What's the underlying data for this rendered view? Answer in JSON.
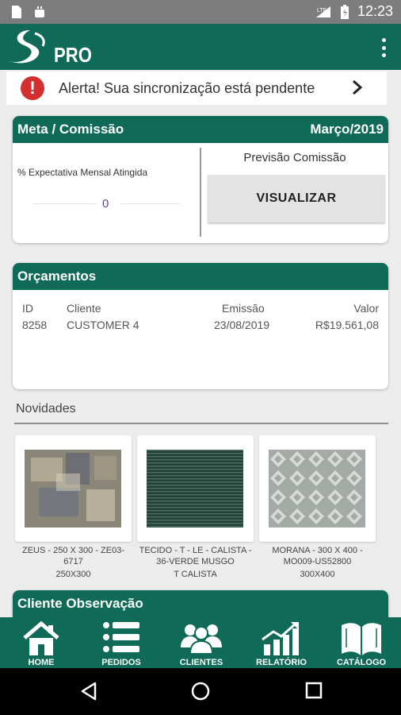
{
  "statusbar": {
    "time": "12:23"
  },
  "appbar": {
    "brand": "PRO"
  },
  "alert": {
    "icon": "!",
    "text": "Alerta! Sua sincronização está pendente"
  },
  "meta": {
    "title": "Meta / Comissão",
    "month": "Março/2019",
    "expectativa_label": "% Expectativa Mensal Atingida",
    "expectativa_value": "0",
    "previsao_label": "Previsão Comissão",
    "visualizar_label": "VISUALIZAR"
  },
  "orcamentos": {
    "title": "Orçamentos",
    "headers": {
      "id": "ID",
      "cliente": "Cliente",
      "emissao": "Emissão",
      "valor": "Valor"
    },
    "rows": [
      {
        "id": "8258",
        "cliente": "CUSTOMER 4",
        "emissao": "23/08/2019",
        "valor": "R$19.561,08"
      }
    ]
  },
  "novidades": {
    "title": "Novidades",
    "items": [
      {
        "name": "ZEUS - 250 X 300 - ZE03-6717",
        "sub": "250X300"
      },
      {
        "name": "TECIDO - T - LE - CALISTA - 36-VERDE MUSGO",
        "sub": "T CALISTA"
      },
      {
        "name": "MORANA - 300 X 400 - MO009-US52800",
        "sub": "300X400"
      }
    ]
  },
  "observacao": {
    "title": "Cliente Observação"
  },
  "bottomnav": {
    "items": [
      {
        "label": "HOME"
      },
      {
        "label": "PEDIDOS"
      },
      {
        "label": "CLIENTES"
      },
      {
        "label": "RELATÓRIO"
      },
      {
        "label": "CATÁLOGO"
      }
    ]
  },
  "colors": {
    "primary": "#0f6b57",
    "alert": "#d32f2f",
    "value": "#5a47a8"
  }
}
